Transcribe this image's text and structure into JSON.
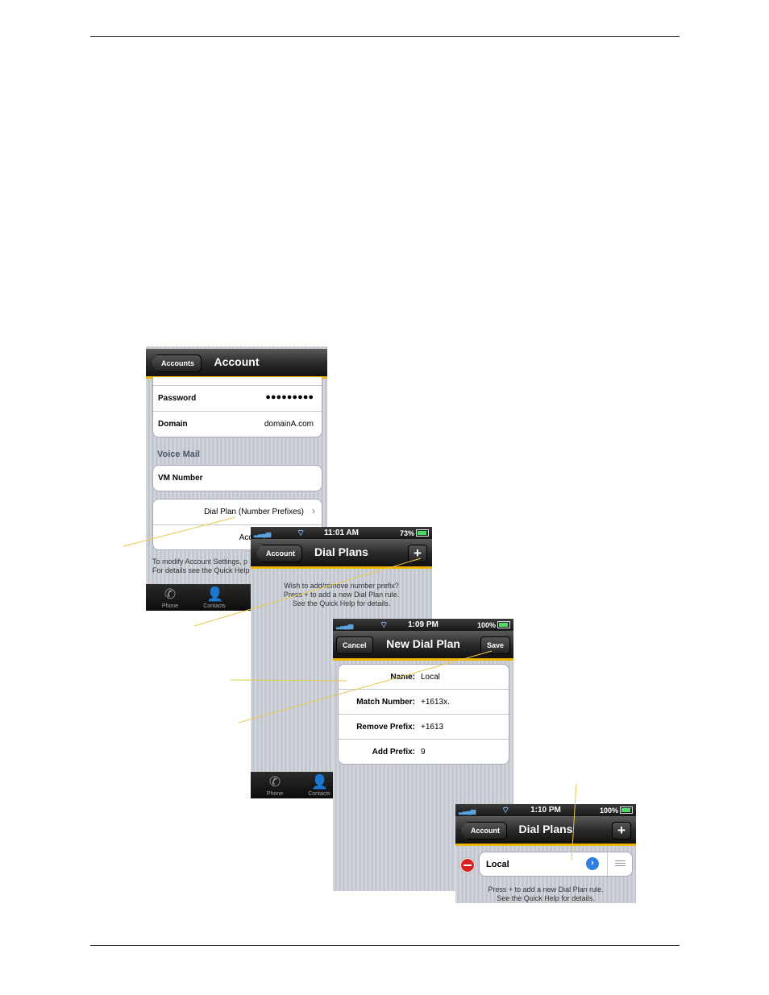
{
  "screen1": {
    "title": "Account",
    "back": "Accounts",
    "rows1": [
      {
        "label": "Password",
        "value": "●●●●●●●●●"
      },
      {
        "label": "Domain",
        "value": "domainA.com"
      }
    ],
    "section_vm": "Voice Mail",
    "vm_label": "VM Number",
    "dial_plan_row": "Dial Plan (Number Prefixes)",
    "account_row_partial": "Acco",
    "note_line1": "To modify Account Settings, p",
    "note_line2": "For details see the Quick Help",
    "tabs": [
      "Phone",
      "Contacts"
    ]
  },
  "screen2": {
    "time": "11:01 AM",
    "battery": "73%",
    "title": "Dial Plans",
    "back": "Account",
    "plus": "+",
    "msg1": "Wish to add/remove number prefix?",
    "msg2": "Press + to add a new Dial Plan rule.",
    "msg3": "See the Quick Help for details.",
    "tabs": [
      "Phone",
      "Contacts"
    ]
  },
  "screen3": {
    "time": "1:09 PM",
    "battery": "100%",
    "title": "New Dial Plan",
    "cancel": "Cancel",
    "save": "Save",
    "fields": [
      {
        "label": "Name:",
        "value": "Local"
      },
      {
        "label": "Match Number:",
        "value": "+1613x."
      },
      {
        "label": "Remove Prefix:",
        "value": "+1613"
      },
      {
        "label": "Add Prefix:",
        "value": "9"
      }
    ]
  },
  "screen4": {
    "time": "1:10 PM",
    "battery": "100%",
    "title": "Dial Plans",
    "back": "Account",
    "plus": "+",
    "item": "Local",
    "msg1": "Press + to add a new Dial Plan rule.",
    "msg2": "See the Quick Help for details."
  },
  "colors": {
    "accent": "#f0b400",
    "callout": "#e8c84a"
  }
}
